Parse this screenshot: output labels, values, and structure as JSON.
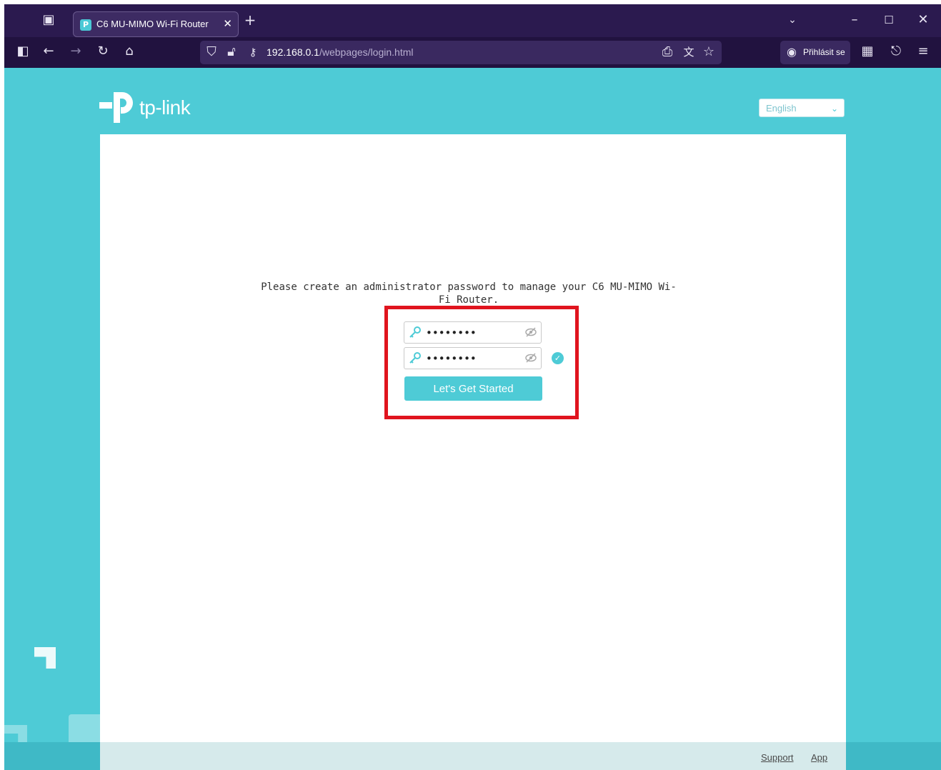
{
  "browser": {
    "tab_title": "C6 MU-MIMO Wi-Fi Router",
    "url_host": "192.168.0.1",
    "url_path": "/webpages/login.html",
    "signin_label": "Přihlásit se"
  },
  "header": {
    "logo_text": "tp-link",
    "language": "English"
  },
  "login": {
    "prompt": "Please create an administrator password to manage your C6 MU-MIMO Wi-Fi Router.",
    "password_mask": "••••••••",
    "confirm_mask": "••••••••",
    "submit_label": "Let's Get Started"
  },
  "footer": {
    "support": "Support",
    "app": "App"
  },
  "colors": {
    "brand_teal": "#4ecbd6",
    "highlight_red": "#e0141e",
    "browser_purple": "#2b1a4f"
  }
}
